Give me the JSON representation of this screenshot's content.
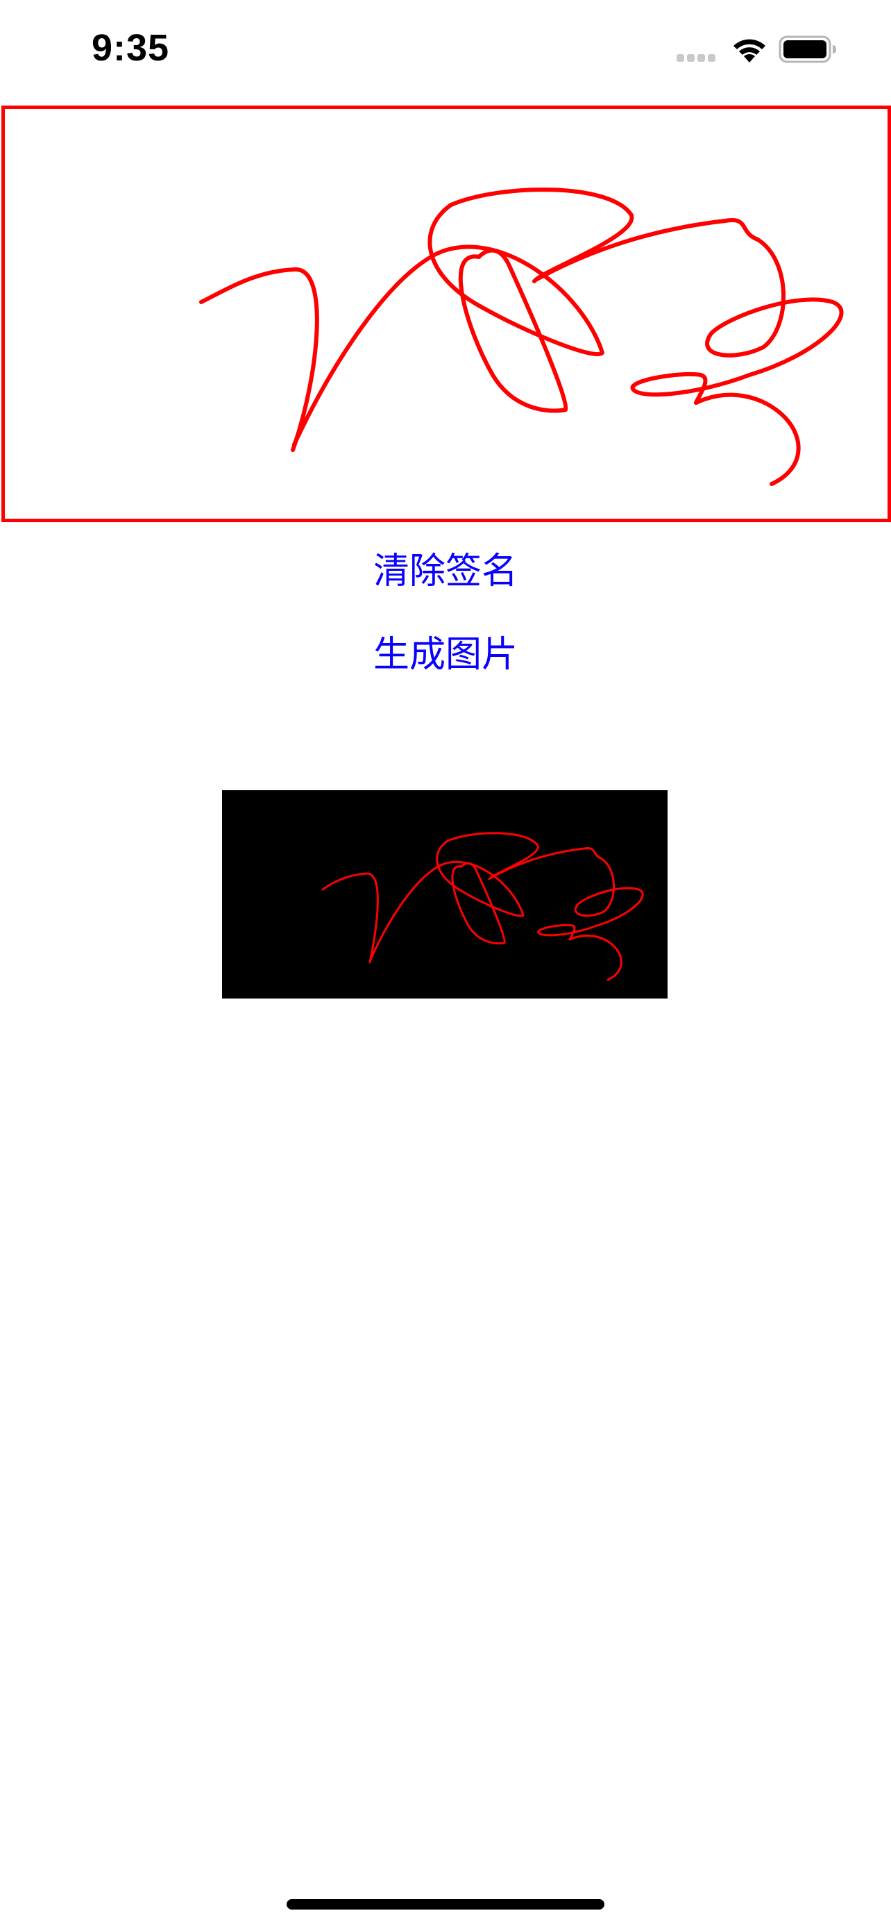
{
  "status_bar": {
    "time": "9:35",
    "signal_icon": "cellular-signal-icon",
    "wifi_icon": "wifi-icon",
    "battery_icon": "battery-icon"
  },
  "signature_pad": {
    "stroke_color": "#ff0000",
    "border_color": "#ff0000"
  },
  "buttons": {
    "clear_label": "清除签名",
    "generate_label": "生成图片",
    "text_color": "#0a00ff"
  },
  "preview": {
    "background": "#000000",
    "stroke_color": "#ff0000"
  }
}
